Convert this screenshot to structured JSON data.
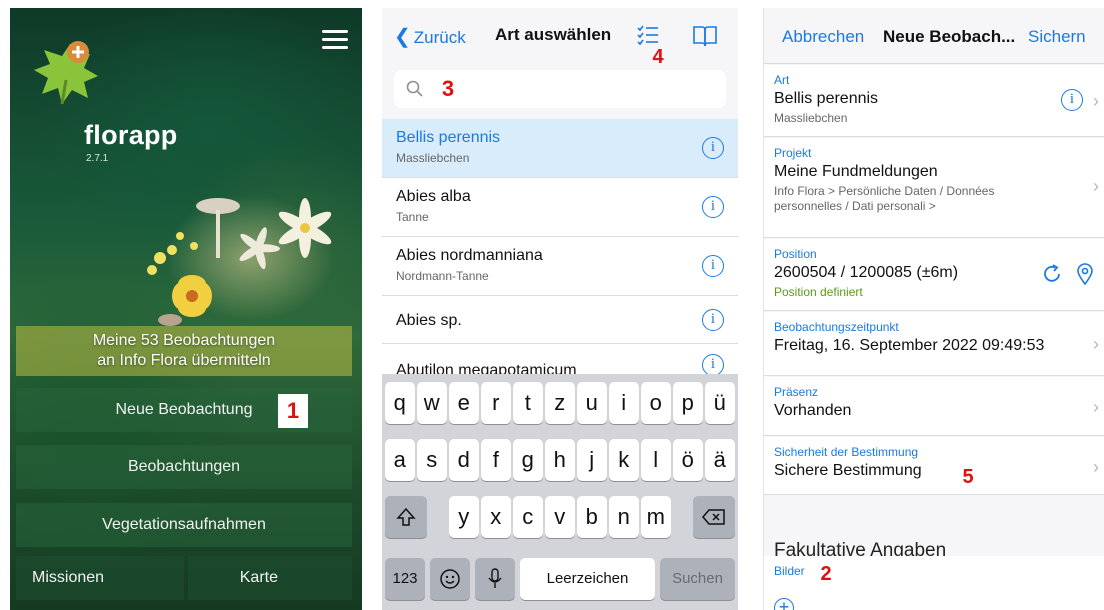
{
  "screen1": {
    "app_name": "florapp",
    "version": "2.7.1",
    "sync_line1": "Meine 53 Beobachtungen",
    "sync_line2": "an Info Flora übermitteln",
    "new_observation": "Neue Beobachtung",
    "observations": "Beobachtungen",
    "vegetation": "Vegetationsaufnahmen",
    "missions": "Missionen",
    "map": "Karte",
    "badge": "1"
  },
  "screen2": {
    "back": "Zurück",
    "title": "Art auswählen",
    "badge_search": "3",
    "badge_list": "4",
    "list": [
      {
        "sci": "Bellis perennis",
        "common": "Massliebchen"
      },
      {
        "sci": "Abies alba",
        "common": "Tanne"
      },
      {
        "sci": "Abies nordmanniana",
        "common": "Nordmann-Tanne"
      },
      {
        "sci": "Abies sp.",
        "common": ""
      },
      {
        "sci": "Abutilon megapotamicum",
        "common": ""
      }
    ],
    "keys_row1": [
      "q",
      "w",
      "e",
      "r",
      "t",
      "z",
      "u",
      "i",
      "o",
      "p",
      "ü"
    ],
    "keys_row2": [
      "a",
      "s",
      "d",
      "f",
      "g",
      "h",
      "j",
      "k",
      "l",
      "ö",
      "ä"
    ],
    "keys_row3": [
      "y",
      "x",
      "c",
      "v",
      "b",
      "n",
      "m"
    ],
    "key_numbers": "123",
    "key_space": "Leerzeichen",
    "key_search": "Suchen"
  },
  "screen3": {
    "cancel": "Abbrechen",
    "title": "Neue Beobach...",
    "save": "Sichern",
    "species_label": "Art",
    "species_value": "Bellis perennis",
    "species_sub": "Massliebchen",
    "project_label": "Projekt",
    "project_value": "Meine Fundmeldungen",
    "project_sub": "Info Flora > Persönliche Daten / Données personnelles / Dati personali >",
    "position_label": "Position",
    "position_value": "2600504 / 1200085 (±6m)",
    "position_sub": "Position definiert",
    "time_label": "Beobachtungszeitpunkt",
    "time_value": "Freitag, 16. September 2022 09:49:53",
    "presence_label": "Präsenz",
    "presence_value": "Vorhanden",
    "certainty_label": "Sicherheit der Bestimmung",
    "certainty_value": "Sichere Bestimmung",
    "badge_certainty": "5",
    "optional_section": "Fakultative Angaben",
    "images_label": "Bilder",
    "badge_images": "2"
  },
  "colors": {
    "accent": "#1a7ae2",
    "badge_text": "#e01010",
    "green_status": "#5a9a1a"
  }
}
